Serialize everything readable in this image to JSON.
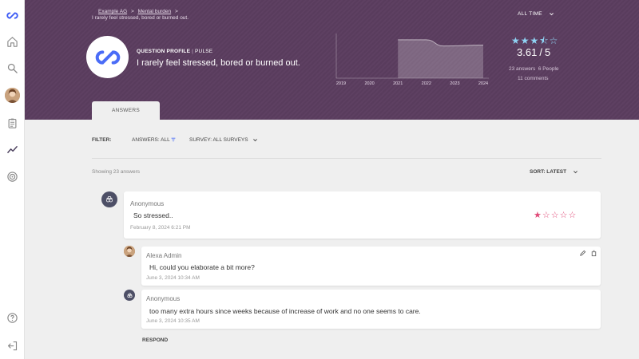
{
  "colors": {
    "header_bg": "#5b3d5f",
    "accent": "#4a6cf7",
    "star_top": "#8fd3f4",
    "star_card": "#e04a78"
  },
  "sidebar": {
    "icons": [
      "logo-icon",
      "home-icon",
      "search-icon",
      "user-avatar",
      "clipboard-icon",
      "trend-icon",
      "target-icon",
      "help-icon",
      "logout-icon"
    ]
  },
  "header": {
    "breadcrumb": [
      "Example AG",
      "Mental burden"
    ],
    "breadcrumb_sep": ">",
    "sub_breadcrumb": "I rarely feel stressed, bored or burned out.",
    "range_filter": "ALL TIME",
    "question_type": "QUESTION PROFILE",
    "question_subtype": "PULSE",
    "question": "I rarely feel stressed, bored or burned out.",
    "rating_value": "3.61",
    "rating_max": "5",
    "answers_count": "23 answers",
    "people_count": "6 People",
    "comments_count": "11 comments",
    "tab": "ANSWERS"
  },
  "chart_data": {
    "type": "area",
    "x": [
      "2019",
      "2020",
      "2021",
      "2022",
      "2023",
      "2024"
    ],
    "ylim": [
      0,
      5
    ],
    "series": [
      {
        "points": [
          [
            "2021",
            4.3
          ],
          [
            "2022",
            4.3
          ],
          [
            "2022.6",
            3.6
          ],
          [
            "2024",
            3.7
          ]
        ]
      }
    ]
  },
  "filters": {
    "label": "FILTER:",
    "answers": "ANSWERS: ALL",
    "survey": "SURVEY: ALL SURVEYS",
    "showing": "Showing 23 answers",
    "sort": "SORT: LATEST"
  },
  "answers": [
    {
      "author": "Anonymous",
      "text": "So stressed..",
      "date": "February 8, 2024 6:21 PM",
      "stars": 1,
      "stars_max": 5,
      "replies": [
        {
          "author": "Alexa Admin",
          "text": "Hi, could you elaborate a bit more?",
          "date": "June 3, 2024 10:34 AM"
        },
        {
          "author": "Anonymous",
          "text": "too many extra hours since weeks because of increase of work and no one seems to care.",
          "date": "June 3, 2024 10:35 AM"
        }
      ],
      "respond_label": "RESPOND"
    }
  ]
}
